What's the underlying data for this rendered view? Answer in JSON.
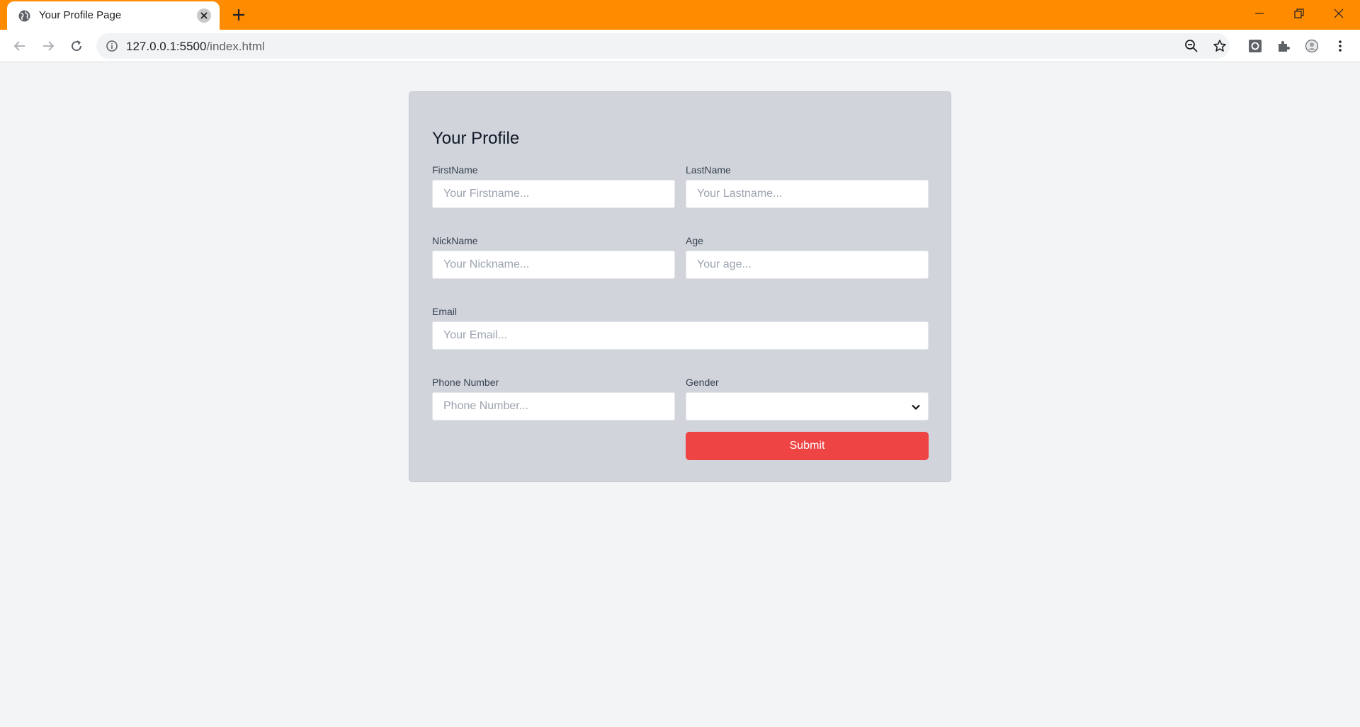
{
  "browser": {
    "tab_title": "Your Profile Page",
    "url_host": "127.0.0.1:5500",
    "url_path": "/index.html",
    "accent_color": "#ff8c00"
  },
  "form": {
    "title": "Your Profile",
    "fields": {
      "firstname": {
        "label": "FirstName",
        "placeholder": "Your Firstname..."
      },
      "lastname": {
        "label": "LastName",
        "placeholder": "Your Lastname..."
      },
      "nickname": {
        "label": "NickName",
        "placeholder": "Your Nickname..."
      },
      "age": {
        "label": "Age",
        "placeholder": "Your age..."
      },
      "email": {
        "label": "Email",
        "placeholder": "Your Email..."
      },
      "phone": {
        "label": "Phone Number",
        "placeholder": "Phone Number..."
      },
      "gender": {
        "label": "Gender",
        "value": ""
      }
    },
    "submit_label": "Submit",
    "submit_color": "#ef4444"
  }
}
